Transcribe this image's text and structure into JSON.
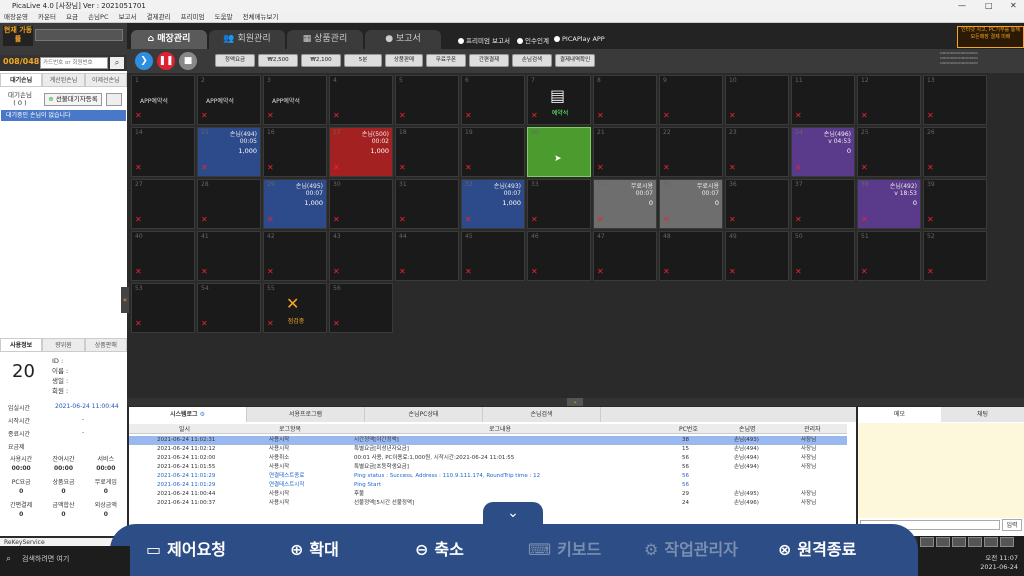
{
  "window": {
    "title": "PicaLive 4.0 [사장님] Ver : 2021051701"
  },
  "menu": [
    "매장운영",
    "카운터",
    "요금",
    "손님PC",
    "보고서",
    "결제관리",
    "프리미엄",
    "도움말",
    "전체메뉴보기"
  ],
  "sidebar": {
    "current_label": "현재 가동률",
    "count": "008/048",
    "search_placeholder": "카드번호 or 회원번호",
    "tabs": [
      "대기손님",
      "계산된손님",
      "이제선손님"
    ],
    "waiting_label": "대기손님",
    "waiting_count": "( 0 )",
    "waiting_button": "선불대기자등록",
    "waiting_empty": "대기중인 손님이 없습니다",
    "user_tabs": [
      "사용정보",
      "량위원",
      "상품판매"
    ],
    "user_seat": "20",
    "user_fields": [
      "ID :",
      "이름 :",
      "생일 :",
      "회원 :"
    ],
    "rows": [
      {
        "label": "입실시간",
        "value": "2021-06-24 11:00:44"
      },
      {
        "label": "시작시간",
        "value": "-"
      },
      {
        "label": "종료시간",
        "value": "-"
      },
      {
        "label": "요금제",
        "value": ""
      }
    ],
    "time_heads": [
      "사용시간",
      "잔여시간",
      "서비스"
    ],
    "time_vals": [
      "00:00",
      "00:00",
      "00:00"
    ],
    "pay_heads": [
      "PC요금",
      "상품요금",
      "무료게임"
    ],
    "pay_vals": [
      "0",
      "0",
      "0"
    ],
    "misc_heads": [
      "간편결제",
      "금액합산",
      "외상금액"
    ],
    "misc_vals": [
      "0",
      "0",
      "0"
    ],
    "reckey": "ReKeyService"
  },
  "nav": {
    "tabs": [
      "매장관리",
      "회원관리",
      "상품관리",
      "보고서"
    ],
    "radios": [
      "프리미엄 보고서",
      "인수인계",
      "PICAPlay APP"
    ],
    "promo": "인터넷 사고, PC기부를 통해 모든매장 결제 미배"
  },
  "toolbar": {
    "buttons": [
      "정액요금",
      "₩2,500",
      "₩2,100",
      "5분",
      "상품판매",
      "무료쿠폰",
      "간편결제",
      "손님검색",
      "결제내역확인"
    ]
  },
  "seats": [
    {
      "n": "1",
      "st": "x",
      "lbl": "APP예약석"
    },
    {
      "n": "2",
      "st": "x",
      "lbl": "APP예약석"
    },
    {
      "n": "3",
      "st": "x",
      "lbl": "APP예약석"
    },
    {
      "n": "4",
      "st": "x"
    },
    {
      "n": "5",
      "st": "x"
    },
    {
      "n": "6",
      "st": "x"
    },
    {
      "n": "7",
      "st": "reserve",
      "ico": "예약석"
    },
    {
      "n": "8",
      "st": "x"
    },
    {
      "n": "9",
      "st": "x"
    },
    {
      "n": "10",
      "st": "x"
    },
    {
      "n": "11",
      "st": "x"
    },
    {
      "n": "12",
      "st": "x"
    },
    {
      "n": "13",
      "st": "x"
    },
    {
      "n": "14",
      "st": "x"
    },
    {
      "n": "15",
      "st": "blue",
      "hdr": "손님(494)",
      "t1": "00:05",
      "t2": "1,000"
    },
    {
      "n": "16",
      "st": "x"
    },
    {
      "n": "17",
      "st": "red",
      "hdr": "손님(500)",
      "t1": "00:02",
      "t2": "1,000"
    },
    {
      "n": "18",
      "st": "x"
    },
    {
      "n": "19",
      "st": "x"
    },
    {
      "n": "20",
      "st": "green"
    },
    {
      "n": "21",
      "st": "x"
    },
    {
      "n": "22",
      "st": "x"
    },
    {
      "n": "23",
      "st": "x"
    },
    {
      "n": "24",
      "st": "purple",
      "hdr": "손님(496)",
      "t1": "v 04:53",
      "t2": "0"
    },
    {
      "n": "25",
      "st": "x"
    },
    {
      "n": "26",
      "st": "x"
    },
    {
      "n": "27",
      "st": "x"
    },
    {
      "n": "28",
      "st": "x"
    },
    {
      "n": "29",
      "st": "blue",
      "hdr": "손님(495)",
      "t1": "00:07",
      "t2": "1,000"
    },
    {
      "n": "30",
      "st": "x"
    },
    {
      "n": "31",
      "st": "x"
    },
    {
      "n": "32",
      "st": "blue",
      "hdr": "손님(493)",
      "t1": "00:07",
      "t2": "1,000"
    },
    {
      "n": "33",
      "st": "x"
    },
    {
      "n": "34",
      "st": "gray",
      "hdr": "무료시용",
      "t1": "00:07",
      "t2": "0"
    },
    {
      "n": "35",
      "st": "gray",
      "hdr": "무료시용",
      "t1": "00:07",
      "t2": "0"
    },
    {
      "n": "36",
      "st": "x"
    },
    {
      "n": "37",
      "st": "x"
    },
    {
      "n": "38",
      "st": "purple",
      "hdr": "손님(492)",
      "t1": "v 18:53",
      "t2": "0"
    },
    {
      "n": "39",
      "st": "x"
    },
    {
      "n": "40",
      "st": "x"
    },
    {
      "n": "41",
      "st": "x"
    },
    {
      "n": "42",
      "st": "x"
    },
    {
      "n": "43",
      "st": "x"
    },
    {
      "n": "44",
      "st": "x"
    },
    {
      "n": "45",
      "st": "x"
    },
    {
      "n": "46",
      "st": "x"
    },
    {
      "n": "47",
      "st": "x"
    },
    {
      "n": "48",
      "st": "x"
    },
    {
      "n": "49",
      "st": "x"
    },
    {
      "n": "50",
      "st": "x"
    },
    {
      "n": "51",
      "st": "x"
    },
    {
      "n": "52",
      "st": "x"
    },
    {
      "n": "53",
      "st": "x"
    },
    {
      "n": "54",
      "st": "x"
    },
    {
      "n": "55",
      "st": "repair",
      "ico": "점검중"
    },
    {
      "n": "56",
      "st": "x"
    }
  ],
  "log": {
    "tabs": [
      "시스템로그",
      "서용프로그램",
      "손님PC상태",
      "손님검색"
    ],
    "headers": [
      "일시",
      "로그항목",
      "로그내용",
      "PC번호",
      "손님명",
      "관리자"
    ],
    "rows": [
      {
        "c": [
          "2021-06-24 11:02:31",
          "사용시작",
          "시간정액[야간정액]",
          "38",
          "손님(493)",
          "사장님"
        ],
        "sel": true
      },
      {
        "c": [
          "2021-06-24 11:02:12",
          "사용시작",
          "특별요금[미성년자요금]",
          "15",
          "손님(494)",
          "사장님"
        ]
      },
      {
        "c": [
          "2021-06-24 11:02:00",
          "사용취소",
          "00:01 사용, PC이용료:1,000원, 시작시간:2021-06-24 11:01:55",
          "56",
          "손님(494)",
          "사장님"
        ]
      },
      {
        "c": [
          "2021-06-24 11:01:55",
          "사용시작",
          "특별요금[초등학생요금]",
          "56",
          "손님(494)",
          "사장님"
        ]
      },
      {
        "c": [
          "2021-06-24 11:01:29",
          "연결테스트종료",
          "Ping status : Success, Address : 110.9.111.174, RoundTrip time : 12",
          "56",
          "",
          ""
        ],
        "blue": true
      },
      {
        "c": [
          "2021-06-24 11:01:29",
          "연결테스트시작",
          "Ping Start",
          "56",
          "",
          ""
        ],
        "blue": true
      },
      {
        "c": [
          "2021-06-24 11:00:44",
          "사용시작",
          "후불",
          "29",
          "손님(495)",
          "사장님"
        ]
      },
      {
        "c": [
          "2021-06-24 11:00:37",
          "사용시작",
          "선불정액[5시간 선불정액]",
          "24",
          "손님(496)",
          "사장님"
        ]
      }
    ]
  },
  "memo": {
    "tabs": [
      "메모",
      "채팅"
    ],
    "send": "입력"
  },
  "remote": {
    "buttons": [
      "제어요청",
      "확대",
      "축소",
      "키보드",
      "작업관리자",
      "원격종료"
    ]
  },
  "taskbar": {
    "search": "검색하려면 여기"
  },
  "clock": {
    "time": "오전 11:07",
    "date": "2021-06-24"
  }
}
